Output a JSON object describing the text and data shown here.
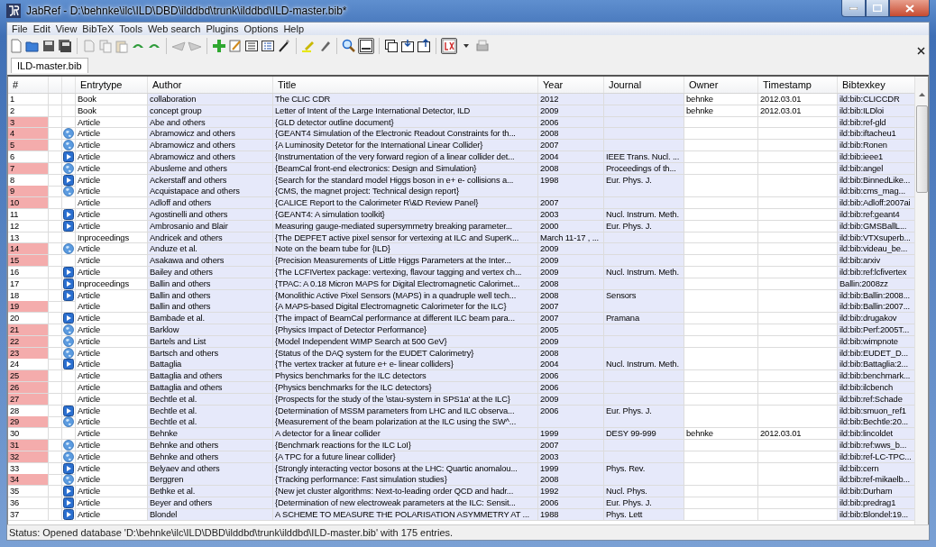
{
  "window": {
    "title": "JabRef - D:\\behnke\\ilc\\ILD\\DBD\\ilddbd\\trunk\\ilddbd\\ILD-master.bib*"
  },
  "menu": [
    "File",
    "Edit",
    "View",
    "BibTeX",
    "Tools",
    "Web search",
    "Plugins",
    "Options",
    "Help"
  ],
  "tabs": [
    {
      "label": "ILD-master.bib",
      "selected": true
    }
  ],
  "table": {
    "columns": [
      "#",
      "Entrytype",
      "Author",
      "Title",
      "Year",
      "Journal",
      "Owner",
      "Timestamp",
      "Bibtexkey"
    ],
    "rows": [
      {
        "number": "1",
        "marked": false,
        "kind": "plain",
        "entrytype": "Book",
        "author": "collaboration",
        "title": "The CLIC CDR",
        "year": "2012",
        "owner": "behnke",
        "timestamp": "2012.03.01",
        "bibtexkey": "ild:bib:CLICCDR"
      },
      {
        "number": "2",
        "marked": false,
        "kind": "plain",
        "entrytype": "Book",
        "author": "concept group",
        "title": "Letter of Intent of the Large International Detector, ILD",
        "year": "2009",
        "owner": "behnke",
        "timestamp": "2012.03.01",
        "bibtexkey": "ild:bib:ILDloi"
      },
      {
        "number": "3",
        "marked": true,
        "kind": "plain",
        "entrytype": "Article",
        "author": "Abe and others",
        "title": "{GLD detector outline document}",
        "year": "2006",
        "bibtexkey": "ild:bib:ref-gld"
      },
      {
        "number": "4",
        "marked": true,
        "kind": "web",
        "entrytype": "Article",
        "author": "Abramowicz and others",
        "title": "{GEANT4 Simulation of the Electronic Readout Constraints for th...",
        "year": "2008",
        "bibtexkey": "ild:bib:iftacheu1"
      },
      {
        "number": "5",
        "marked": true,
        "kind": "web",
        "entrytype": "Article",
        "author": "Abramowicz and others",
        "title": "{A Luminosity Detetor for the International Linear Collider}",
        "year": "2007",
        "bibtexkey": "ild:bib:Ronen"
      },
      {
        "number": "6",
        "marked": false,
        "kind": "pdf",
        "entrytype": "Article",
        "author": "Abramowicz and others",
        "title": "{Instrumentation of the very forward region of a linear collider det...",
        "year": "2004",
        "journal": "IEEE Trans. Nucl. ...",
        "bibtexkey": "ild:bib:ieee1"
      },
      {
        "number": "7",
        "marked": true,
        "kind": "web",
        "entrytype": "Article",
        "author": "Abusleme and others",
        "title": "{BeamCal front-end electronics: Design and Simulation}",
        "year": "2008",
        "journal": "Proceedings of th...",
        "bibtexkey": "ild:bib:angel"
      },
      {
        "number": "8",
        "marked": false,
        "kind": "pdf",
        "entrytype": "Article",
        "author": "Ackerstaff and others",
        "title": "{Search for the standard model Higgs boson in e+ e- collisions a...",
        "year": "1998",
        "journal": "Eur. Phys. J.",
        "bibtexkey": "ild:bib:BinnedLike..."
      },
      {
        "number": "9",
        "marked": true,
        "kind": "web",
        "entrytype": "Article",
        "author": "Acquistapace and others",
        "title": "{CMS, the magnet project: Technical design report}",
        "bibtexkey": "ild:bib:cms_mag..."
      },
      {
        "number": "10",
        "marked": true,
        "kind": "plain",
        "entrytype": "Article",
        "author": "Adloff and others",
        "title": "{CALICE Report to the Calorimeter R\\&D Review Panel}",
        "year": "2007",
        "bibtexkey": "ild:bib:Adloff:2007ai"
      },
      {
        "number": "11",
        "marked": false,
        "kind": "pdf",
        "entrytype": "Article",
        "author": "Agostinelli and others",
        "title": "{GEANT4: A simulation toolkit}",
        "year": "2003",
        "journal": "Nucl. Instrum. Meth.",
        "bibtexkey": "ild:bib:ref:geant4"
      },
      {
        "number": "12",
        "marked": false,
        "kind": "pdf",
        "entrytype": "Article",
        "author": "Ambrosanio and Blair",
        "title": "Measuring gauge-mediated supersymmetry breaking parameter...",
        "year": "2000",
        "journal": "Eur. Phys. J.",
        "bibtexkey": "ild:bib:GMSBallL..."
      },
      {
        "number": "13",
        "marked": false,
        "kind": "plain",
        "entrytype": "Inproceedings",
        "author": "Andricek and others",
        "title": "{The DEPFET active pixel sensor for vertexing at ILC and SuperK...",
        "year": "March 11-17 , ...",
        "bibtexkey": "ild:bib:VTXsuperb..."
      },
      {
        "number": "14",
        "marked": true,
        "kind": "web",
        "entrytype": "Article",
        "author": "Anduze et al.",
        "title": "Note on the beam tube for {ILD}",
        "year": "2009",
        "bibtexkey": "ild:bib:videau_be..."
      },
      {
        "number": "15",
        "marked": true,
        "kind": "plain",
        "entrytype": "Article",
        "author": "Asakawa and others",
        "title": "{Precision Measurements of Little Higgs Parameters at the Inter...",
        "year": "2009",
        "bibtexkey": "ild:bib:arxiv"
      },
      {
        "number": "16",
        "marked": false,
        "kind": "pdf",
        "entrytype": "Article",
        "author": "Bailey and others",
        "title": "{The LCFIVertex package: vertexing, flavour tagging and vertex ch...",
        "year": "2009",
        "journal": "Nucl. Instrum. Meth.",
        "bibtexkey": "ild:bib:ref:lcfivertex"
      },
      {
        "number": "17",
        "marked": false,
        "kind": "pdf",
        "entrytype": "Inproceedings",
        "author": "Ballin and others",
        "title": "{TPAC: A 0.18 Micron MAPS for Digital Electromagnetic Calorimet...",
        "year": "2008",
        "bibtexkey": "Ballin:2008zz"
      },
      {
        "number": "18",
        "marked": false,
        "kind": "pdf",
        "entrytype": "Article",
        "author": "Ballin and others",
        "title": "{Monolithic Active Pixel Sensors (MAPS) in a quadruple well tech...",
        "year": "2008",
        "journal": "Sensors",
        "bibtexkey": "ild:bib:Ballin:2008..."
      },
      {
        "number": "19",
        "marked": true,
        "kind": "plain",
        "entrytype": "Article",
        "author": "Ballin and others",
        "title": "{A MAPS-based Digital Electromagnetic Calorimeter for the ILC}",
        "year": "2007",
        "bibtexkey": "ild:bib:Ballin:2007..."
      },
      {
        "number": "20",
        "marked": false,
        "kind": "pdf",
        "entrytype": "Article",
        "author": "Bambade et al.",
        "title": "{The impact of BeamCal performance at different ILC beam para...",
        "year": "2007",
        "journal": "Pramana",
        "bibtexkey": "ild:bib:drugakov"
      },
      {
        "number": "21",
        "marked": true,
        "kind": "web",
        "entrytype": "Article",
        "author": "Barklow",
        "title": "{Physics Impact of Detector Performance}",
        "year": "2005",
        "bibtexkey": "ild:bib:Perf:2005T..."
      },
      {
        "number": "22",
        "marked": true,
        "kind": "web",
        "entrytype": "Article",
        "author": "Bartels and List",
        "title": "{Model Independent WIMP Search at 500 GeV}",
        "year": "2009",
        "bibtexkey": "ild:bib:wimpnote"
      },
      {
        "number": "23",
        "marked": true,
        "kind": "web",
        "entrytype": "Article",
        "author": "Bartsch and others",
        "title": "{Status of the DAQ system for the EUDET Calorimetry}",
        "year": "2008",
        "bibtexkey": "ild:bib:EUDET_D..."
      },
      {
        "number": "24",
        "marked": false,
        "kind": "pdf",
        "entrytype": "Article",
        "author": "Battaglia",
        "title": "{The vertex tracker at future e+ e- linear colliders}",
        "year": "2004",
        "journal": "Nucl. Instrum. Meth.",
        "bibtexkey": "ild:bib:Battaglia:2..."
      },
      {
        "number": "25",
        "marked": true,
        "kind": "plain",
        "entrytype": "Article",
        "author": "Battaglia and others",
        "title": "Physics benchmarks for the ILC detectors",
        "year": "2006",
        "bibtexkey": "ild:bib:benchmark..."
      },
      {
        "number": "26",
        "marked": true,
        "kind": "plain",
        "entrytype": "Article",
        "author": "Battaglia and others",
        "title": "{Physics benchmarks for the ILC detectors}",
        "year": "2006",
        "bibtexkey": "ild:bib:ilcbench"
      },
      {
        "number": "27",
        "marked": true,
        "kind": "plain",
        "entrytype": "Article",
        "author": "Bechtle et al.",
        "title": "{Prospects for the study of the \\stau-system in SPS1a' at the ILC}",
        "year": "2009",
        "bibtexkey": "ild:bib:ref:Schade"
      },
      {
        "number": "28",
        "marked": false,
        "kind": "pdf",
        "entrytype": "Article",
        "author": "Bechtle et al.",
        "title": "{Determination of MSSM parameters from LHC and ILC observa...",
        "year": "2006",
        "journal": "Eur. Phys. J.",
        "bibtexkey": "ild:bib:smuon_ref1"
      },
      {
        "number": "29",
        "marked": true,
        "kind": "web",
        "entrytype": "Article",
        "author": "Bechtle et al.",
        "title": "{Measurement of the beam polarization at the ILC using the SW^...",
        "bibtexkey": "ild:bib:Bechtle:20..."
      },
      {
        "number": "30",
        "marked": false,
        "kind": "plain",
        "entrytype": "Article",
        "author": "Behnke",
        "title": "A detector for a linear collider",
        "year": "1999",
        "journal": "DESY 99-999",
        "owner": "behnke",
        "timestamp": "2012.03.01",
        "bibtexkey": "ild:bib:lincoldet"
      },
      {
        "number": "31",
        "marked": true,
        "kind": "web",
        "entrytype": "Article",
        "author": "Behnke and others",
        "title": "{Benchmark reactions for the ILC LoI}",
        "year": "2007",
        "bibtexkey": "ild:bib:ref:wws_b..."
      },
      {
        "number": "32",
        "marked": true,
        "kind": "web",
        "entrytype": "Article",
        "author": "Behnke and others",
        "title": "{A TPC for a future linear collider}",
        "year": "2003",
        "bibtexkey": "ild:bib:ref-LC-TPC..."
      },
      {
        "number": "33",
        "marked": false,
        "kind": "pdf",
        "entrytype": "Article",
        "author": "Belyaev and others",
        "title": "{Strongly interacting vector bosons at the LHC: Quartic anomalou...",
        "year": "1999",
        "journal": "Phys. Rev.",
        "bibtexkey": "ild:bib:cern"
      },
      {
        "number": "34",
        "marked": true,
        "kind": "web",
        "entrytype": "Article",
        "author": "Berggren",
        "title": "{Tracking performance: Fast simulation studies}",
        "year": "2008",
        "bibtexkey": "ild:bib:ref-mikaelb..."
      },
      {
        "number": "35",
        "marked": false,
        "kind": "pdf",
        "entrytype": "Article",
        "author": "Bethke et al.",
        "title": "{New jet cluster algorithms: Next-to-leading order QCD and hadr...",
        "year": "1992",
        "journal": "Nucl. Phys.",
        "bibtexkey": "ild:bib:Durham"
      },
      {
        "number": "36",
        "marked": false,
        "kind": "pdf",
        "entrytype": "Article",
        "author": "Beyer and others",
        "title": "{Determination of new electroweak parameters at the ILC: Sensit...",
        "year": "2006",
        "journal": "Eur. Phys. J.",
        "bibtexkey": "ild:bib:predrag1"
      },
      {
        "number": "37",
        "marked": false,
        "kind": "pdf",
        "entrytype": "Article",
        "author": "Blondel",
        "title": "A SCHEME TO MEASURE THE POLARISATION ASYMMETRY AT ...",
        "year": "1988",
        "journal": "Phys. Lett",
        "bibtexkey": "ild:bib:Blondel:19..."
      }
    ]
  },
  "status_bar": {
    "text": "Status: Opened database 'D:\\behnke\\ilc\\ILD\\DBD\\ilddbd\\trunk\\ilddbd\\ILD-master.bib' with 175 entries."
  }
}
